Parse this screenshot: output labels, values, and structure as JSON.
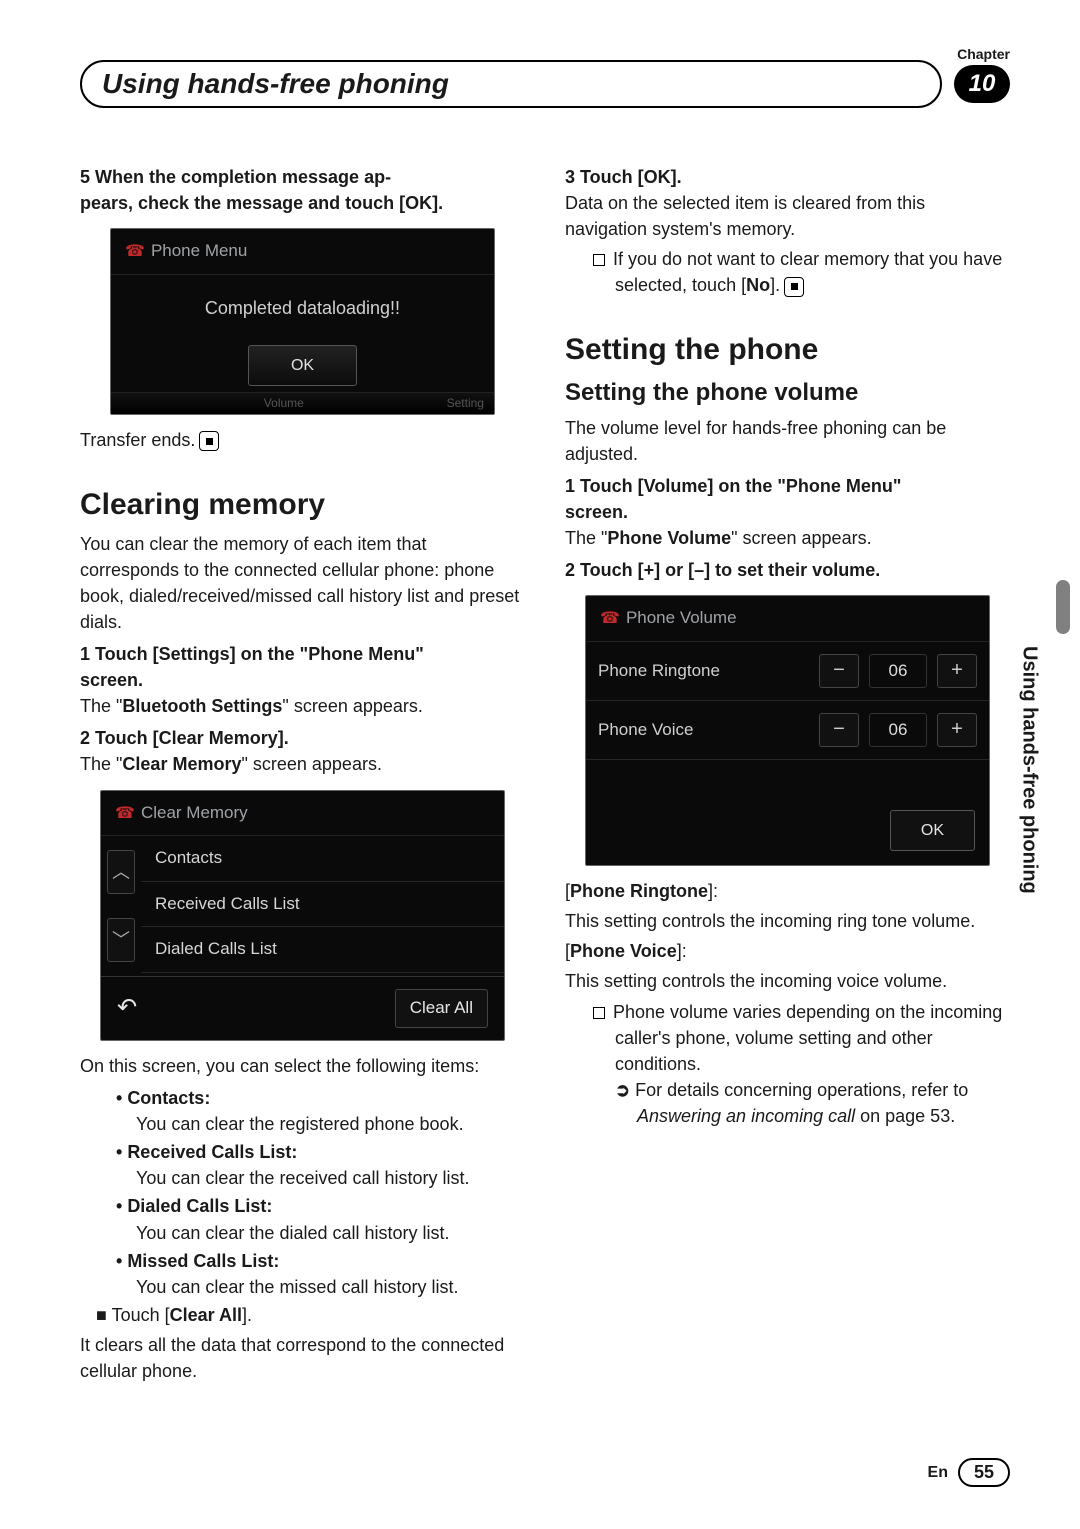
{
  "meta": {
    "chapter_label": "Chapter",
    "chapter_number": "10",
    "lang": "En",
    "page_number": "55"
  },
  "header": {
    "title": "Using hands-free phoning"
  },
  "side_tab": "Using hands-free phoning",
  "left": {
    "step5_line1": "5   When the completion message ap-",
    "step5_line2": "pears, check the message and touch [OK].",
    "ss1": {
      "title": "Phone Menu",
      "body": "Completed dataloading!!",
      "ok": "OK",
      "bottom_left": "",
      "bottom_mid": "Volume",
      "bottom_right": "Setting"
    },
    "transfer_ends": "Transfer ends.",
    "h2_clearing": "Clearing memory",
    "clearing_intro": "You can clear the memory of each item that corresponds to the connected cellular phone: phone book, dialed/received/missed call history list and preset dials.",
    "cm_step1_a": "1   Touch [Settings] on the \"Phone Menu\"",
    "cm_step1_b": "screen.",
    "cm_step1_res_pre": "The \"",
    "cm_step1_res_strong": "Bluetooth Settings",
    "cm_step1_res_post": "\" screen appears.",
    "cm_step2": "2   Touch [Clear Memory].",
    "cm_step2_res_pre": "The \"",
    "cm_step2_res_strong": "Clear Memory",
    "cm_step2_res_post": "\" screen appears.",
    "ss2": {
      "title": "Clear Memory",
      "items": [
        "Contacts",
        "Received Calls List",
        "Dialed Calls List"
      ],
      "clear_all": "Clear All"
    },
    "cm_after": "On this screen, you can select the following items:",
    "bullets": [
      {
        "title": "Contacts:",
        "desc": "You can clear the registered phone book."
      },
      {
        "title": "Received Calls List:",
        "desc": "You can clear the received call history list."
      },
      {
        "title": "Dialed Calls List:",
        "desc": "You can clear the dialed call history list."
      },
      {
        "title": "Missed Calls List:",
        "desc": "You can clear the missed call history list."
      }
    ],
    "touch_clearall_pre": "Touch [",
    "touch_clearall_strong": "Clear All",
    "touch_clearall_post": "].",
    "touch_clearall_desc": "It clears all the data that correspond to the connected cellular phone."
  },
  "right": {
    "step3": "3   Touch [OK].",
    "step3_desc": "Data on the selected item is cleared from this navigation system's memory.",
    "note1_pre": "If you do not want to clear memory that you have selected, touch [",
    "note1_strong": "No",
    "note1_post": "].",
    "h2_setting": "Setting the phone",
    "h3_volume": "Setting the phone volume",
    "vol_intro": "The volume level for hands-free phoning can be adjusted.",
    "vol_step1_a": "1   Touch [Volume] on the \"Phone Menu\"",
    "vol_step1_b": "screen.",
    "vol_step1_res_pre": "The \"",
    "vol_step1_res_strong": "Phone Volume",
    "vol_step1_res_post": "\" screen appears.",
    "vol_step2": "2   Touch [+] or [–] to set their volume.",
    "ss3": {
      "title": "Phone Volume",
      "rows": [
        {
          "label": "Phone Ringtone",
          "value": "06"
        },
        {
          "label": "Phone Voice",
          "value": "06"
        }
      ],
      "ok": "OK"
    },
    "pr_label": "Phone Ringtone",
    "pr_desc": "This setting controls the incoming ring tone volume.",
    "pv_label": "Phone Voice",
    "pv_desc": "This setting controls the incoming voice volume.",
    "note2": "Phone volume varies depending on the incoming caller's phone, volume setting and other conditions.",
    "subnote_pre": "For details concerning operations, refer to ",
    "subnote_em": "Answering an incoming call",
    "subnote_post": " on page 53."
  }
}
